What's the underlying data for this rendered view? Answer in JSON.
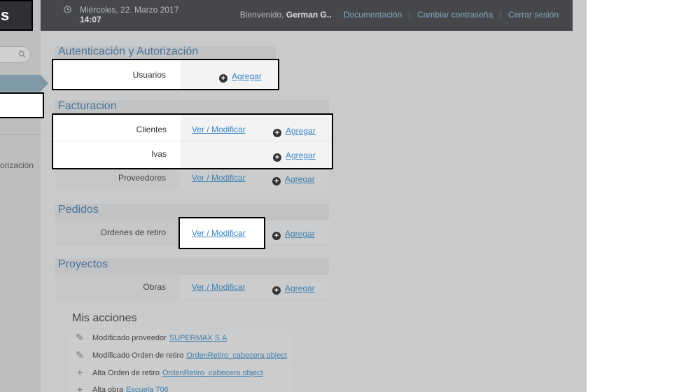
{
  "topbar": {
    "date": "Miércoles, 22. Marzo 2017",
    "time": "14:07",
    "welcome": "Bienvenido,",
    "user": "German G..",
    "links": [
      "Documentación",
      "Cambiar contraseña",
      "Cerrar sesión"
    ]
  },
  "sidebar": {
    "logo_char": "s",
    "item_text": "orización"
  },
  "modules": {
    "auth": {
      "title": "Autenticación y Autorización",
      "rows": [
        {
          "label": "Usuarios",
          "add": "Agregar"
        }
      ]
    },
    "fact": {
      "title": "Facturacion",
      "rows": [
        {
          "label": "Clientes",
          "view": "Ver / Modificar",
          "add": "Agregar"
        },
        {
          "label": "Ivas",
          "add": "Agregar"
        },
        {
          "label": "Proveedores",
          "view": "Ver / Modificar",
          "add": "Agregar"
        }
      ]
    },
    "pedidos": {
      "title": "Pedidos",
      "rows": [
        {
          "label": "Ordenes de retiro",
          "view": "Ver / Modificar",
          "add": "Agregar"
        }
      ]
    },
    "proyectos": {
      "title": "Proyectos",
      "rows": [
        {
          "label": "Obras",
          "view": "Ver / Modificar",
          "add": "Agregar"
        }
      ]
    }
  },
  "actions": {
    "title": "Mis acciones",
    "items": [
      {
        "icon": "pencil-icon",
        "text": "Modificado proveedor",
        "link": "SUPERMAX S.A"
      },
      {
        "icon": "pencil-icon",
        "text": "Modificado Orden de retiro",
        "link": "OrdenRetiro_cabecera object"
      },
      {
        "icon": "plus-icon",
        "text": "Alta Orden de retiro",
        "link": "OrdenRetiro_cabecera object"
      },
      {
        "icon": "plus-icon",
        "text": "Alta obra",
        "link": "Escuela 706"
      }
    ]
  }
}
